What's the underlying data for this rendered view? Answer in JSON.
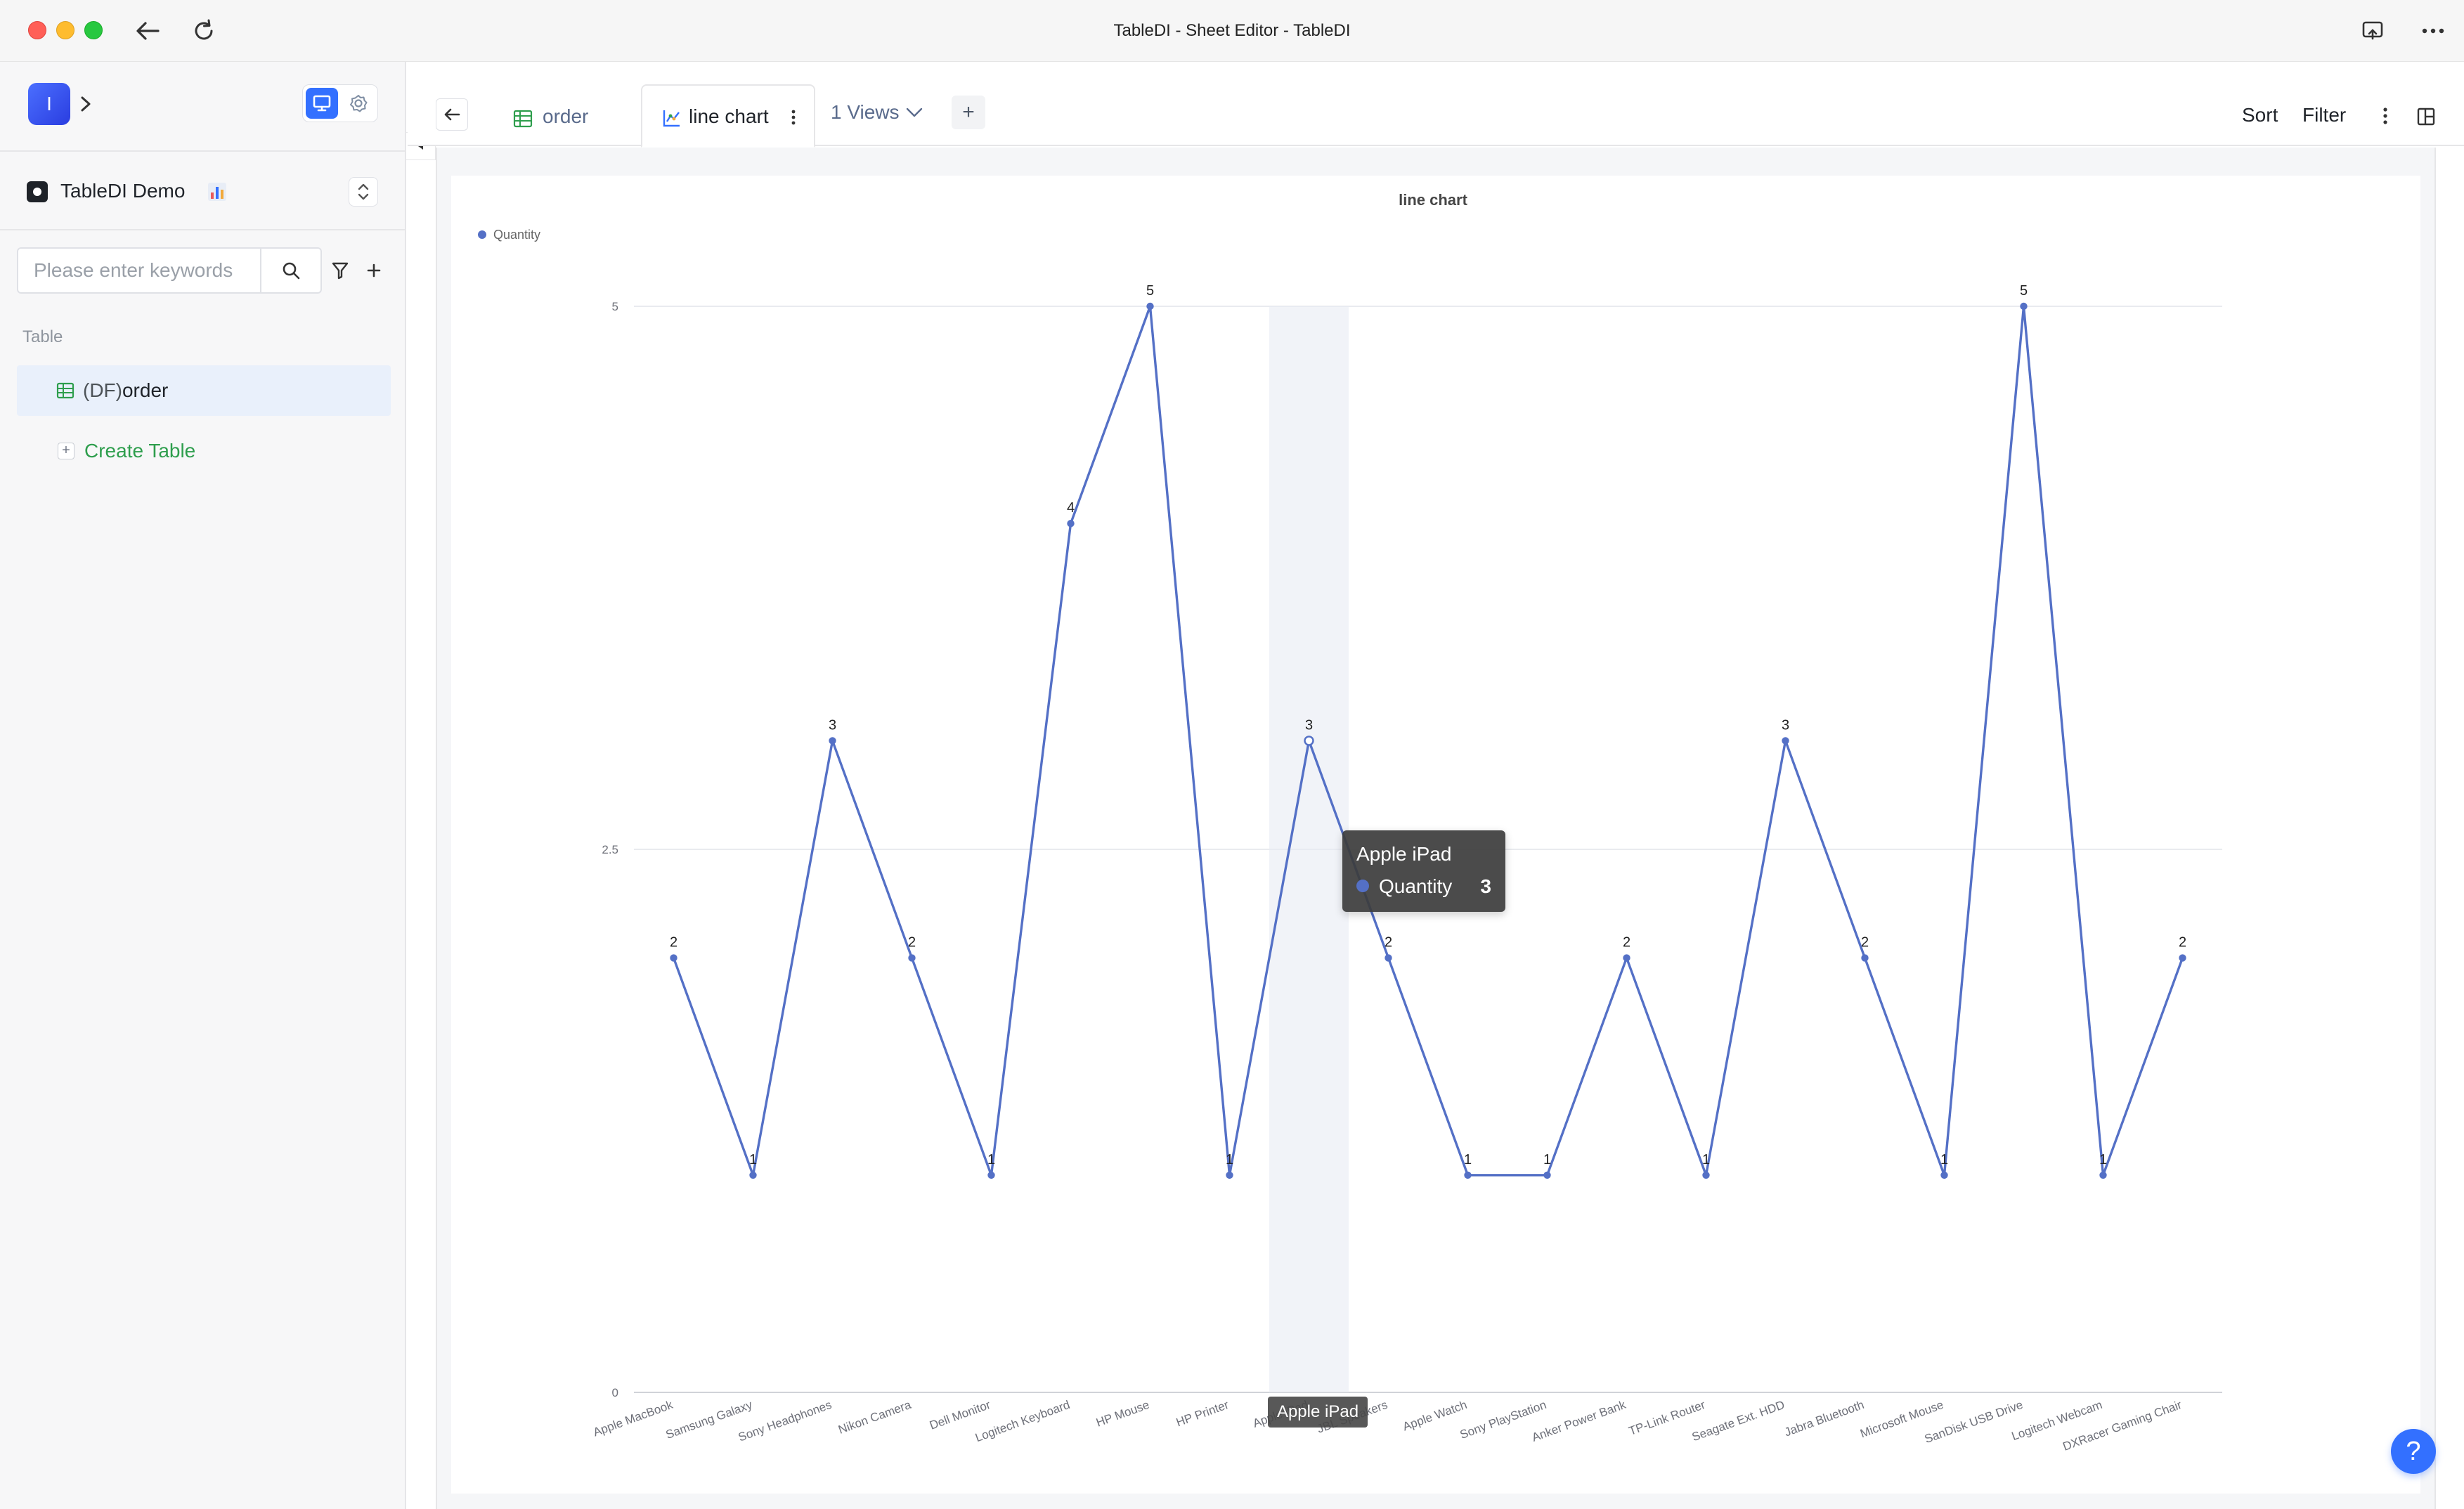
{
  "window": {
    "title": "TableDI - Sheet Editor - TableDI"
  },
  "sidebar": {
    "avatar_letter": "I",
    "project_name": "TableDI Demo",
    "search_placeholder": "Please enter keywords",
    "section_label": "Table",
    "table_prefix": "(DF)",
    "table_name": "order",
    "create_label": "Create Table"
  },
  "header": {
    "tabs": [
      {
        "label": "order"
      },
      {
        "label": "line chart"
      }
    ],
    "views_label": "1 Views",
    "add_label": "+",
    "sort_label": "Sort",
    "filter_label": "Filter"
  },
  "colors": {
    "accent": "#3370ff",
    "series": "#5470c6",
    "create_link": "#2e9e4d"
  },
  "chart_data": {
    "type": "line",
    "title": "line chart",
    "legend": "top-left",
    "grid": true,
    "ylim": [
      0,
      5
    ],
    "yticks": [
      "0",
      "2.5",
      "5"
    ],
    "categories": [
      "Apple MacBook",
      "Samsung Galaxy",
      "Sony Headphones",
      "Nikon Camera",
      "Dell Monitor",
      "Logitech Keyboard",
      "HP Mouse",
      "HP Printer",
      "Apple iPad",
      "JBL Speakers",
      "Apple Watch",
      "Sony PlayStation",
      "Anker Power Bank",
      "TP-Link Router",
      "Seagate Ext. HDD",
      "Jabra Bluetooth",
      "Microsoft Mouse",
      "SanDisk USB Drive",
      "Logitech Webcam",
      "DXRacer Gaming Chair"
    ],
    "series": [
      {
        "name": "Quantity",
        "values": [
          2,
          1,
          3,
          2,
          1,
          4,
          5,
          1,
          3,
          2,
          1,
          1,
          2,
          1,
          3,
          2,
          1,
          5,
          1,
          2
        ]
      }
    ],
    "highlighted_category": "Apple iPad"
  },
  "tooltip": {
    "title": "Apple iPad",
    "series": "Quantity",
    "value": "3",
    "axis_label": "Apple iPad"
  },
  "help": {
    "label": "?"
  }
}
